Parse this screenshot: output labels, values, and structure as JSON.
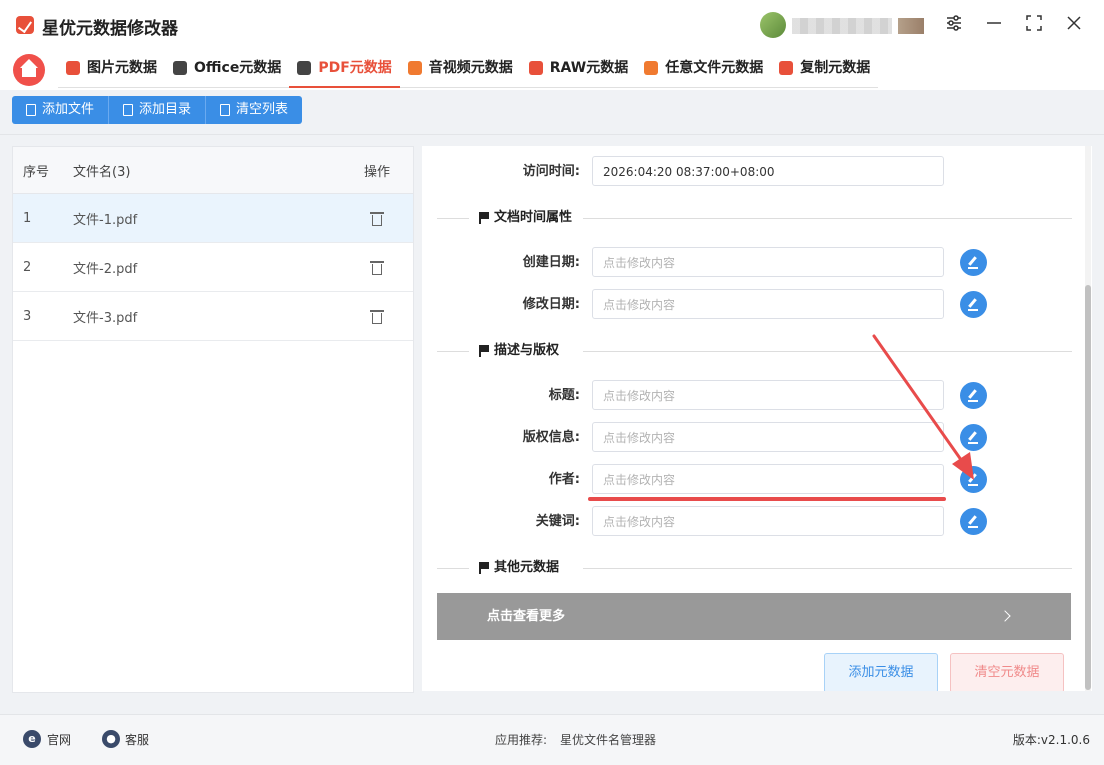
{
  "app": {
    "title": "星优元数据修改器"
  },
  "tabs": [
    {
      "label": "图片元数据",
      "icon": "image-icon",
      "color": "#e8503a"
    },
    {
      "label": "Office元数据",
      "icon": "office-icon",
      "color": "#444444"
    },
    {
      "label": "PDF元数据",
      "icon": "pdf-icon",
      "color": "#e8503a"
    },
    {
      "label": "音视频元数据",
      "icon": "video-icon",
      "color": "#f07a30"
    },
    {
      "label": "RAW元数据",
      "icon": "raw-icon",
      "color": "#e8503a"
    },
    {
      "label": "任意文件元数据",
      "icon": "file-icon",
      "color": "#f07a30"
    },
    {
      "label": "复制元数据",
      "icon": "copy-icon",
      "color": "#e8503a"
    }
  ],
  "toolbar": {
    "add_file": "添加文件",
    "add_dir": "添加目录",
    "clear_list": "清空列表"
  },
  "filelist": {
    "headers": {
      "index": "序号",
      "name": "文件名(3)",
      "action": "操作"
    },
    "rows": [
      {
        "index": "1",
        "name": "文件-1.pdf"
      },
      {
        "index": "2",
        "name": "文件-2.pdf"
      },
      {
        "index": "3",
        "name": "文件-3.pdf"
      }
    ]
  },
  "panel": {
    "access_time": {
      "label": "访问时间:",
      "value": "2026:04:20 08:37:00+08:00"
    },
    "section_time": "文档时间属性",
    "created": {
      "label": "创建日期:",
      "placeholder": "点击修改内容"
    },
    "modified": {
      "label": "修改日期:",
      "placeholder": "点击修改内容"
    },
    "section_desc": "描述与版权",
    "title": {
      "label": "标题:",
      "placeholder": "点击修改内容"
    },
    "copyright": {
      "label": "版权信息:",
      "placeholder": "点击修改内容"
    },
    "author": {
      "label": "作者:",
      "placeholder": "点击修改内容"
    },
    "keywords": {
      "label": "关键词:",
      "placeholder": "点击修改内容"
    },
    "section_other": "其他元数据",
    "more": "点击查看更多",
    "add_meta": "添加元数据",
    "clear_meta": "清空元数据"
  },
  "footer": {
    "website": "官网",
    "support": "客服",
    "recommend_label": "应用推荐:",
    "recommend_app": "星优文件名管理器",
    "version": "版本:v2.1.0.6"
  },
  "colors": {
    "accent": "#e8503a",
    "primary": "#3a8ee6",
    "annotation": "#e84b4b"
  }
}
